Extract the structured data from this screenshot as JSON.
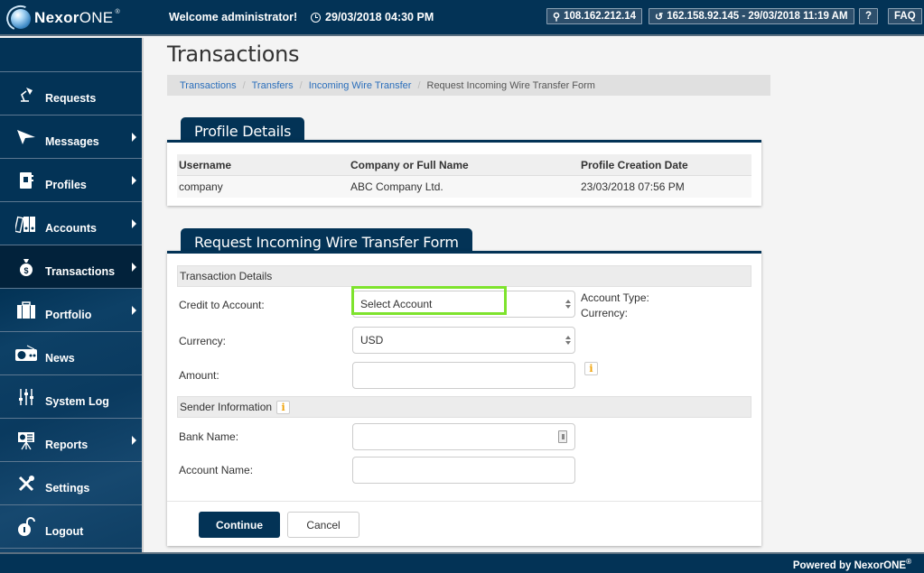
{
  "app": {
    "brand_bold": "Nexor",
    "brand_light": "ONE",
    "brand_reg": "®"
  },
  "header": {
    "welcome_prefix": "Welcome ",
    "welcome_user": "administrator!",
    "datetime": "29/03/2018 04:30 PM",
    "ip": "108.162.212.14",
    "last_login": "162.158.92.145 - 29/03/2018 11:19 AM",
    "help_label": "?",
    "faq_label": "FAQ"
  },
  "sidebar": {
    "items": [
      {
        "label": "Requests",
        "icon": "desk-lamp-icon",
        "has_submenu": false,
        "active": false
      },
      {
        "label": "Messages",
        "icon": "paper-plane-icon",
        "has_submenu": true,
        "active": false
      },
      {
        "label": "Profiles",
        "icon": "address-book-icon",
        "has_submenu": true,
        "active": false
      },
      {
        "label": "Accounts",
        "icon": "binders-icon",
        "has_submenu": true,
        "active": false
      },
      {
        "label": "Transactions",
        "icon": "money-bag-icon",
        "has_submenu": true,
        "active": true
      },
      {
        "label": "Portfolio",
        "icon": "briefcase-icon",
        "has_submenu": true,
        "active": false
      },
      {
        "label": "News",
        "icon": "radio-icon",
        "has_submenu": false,
        "active": false
      },
      {
        "label": "System Log",
        "icon": "sliders-icon",
        "has_submenu": false,
        "active": false
      },
      {
        "label": "Reports",
        "icon": "presentation-icon",
        "has_submenu": true,
        "active": false
      },
      {
        "label": "Settings",
        "icon": "tools-icon",
        "has_submenu": false,
        "active": false
      },
      {
        "label": "Logout",
        "icon": "unlock-icon",
        "has_submenu": false,
        "active": false
      }
    ]
  },
  "page": {
    "title": "Transactions",
    "breadcrumb": [
      "Transactions",
      "Transfers",
      "Incoming Wire Transfer"
    ],
    "breadcrumb_current": "Request Incoming Wire Transfer Form"
  },
  "profile_details": {
    "title": "Profile Details",
    "columns": [
      "Username",
      "Company or Full Name",
      "Profile Creation Date"
    ],
    "rows": [
      [
        "company",
        "ABC Company Ltd.",
        "23/03/2018 07:56 PM"
      ]
    ]
  },
  "form": {
    "title": "Request Incoming Wire Transfer Form",
    "section_transaction": "Transaction Details",
    "credit_label": "Credit to Account:",
    "credit_value": "Select Account",
    "account_type_label": "Account Type:",
    "account_currency_label": "Currency:",
    "currency_label": "Currency:",
    "currency_value": "USD",
    "amount_label": "Amount:",
    "amount_value": "",
    "section_sender": "Sender Information",
    "bank_name_label": "Bank Name:",
    "bank_name_value": "",
    "account_name_label": "Account Name:",
    "account_name_value": "",
    "info_glyph": "i",
    "continue_label": "Continue",
    "cancel_label": "Cancel"
  },
  "footer": {
    "text": "Powered by NexorONE",
    "reg": "®"
  },
  "colors": {
    "primary": "#033356",
    "highlight": "#7ee32d",
    "info": "#f0a30a",
    "link": "#2a6ebb"
  }
}
